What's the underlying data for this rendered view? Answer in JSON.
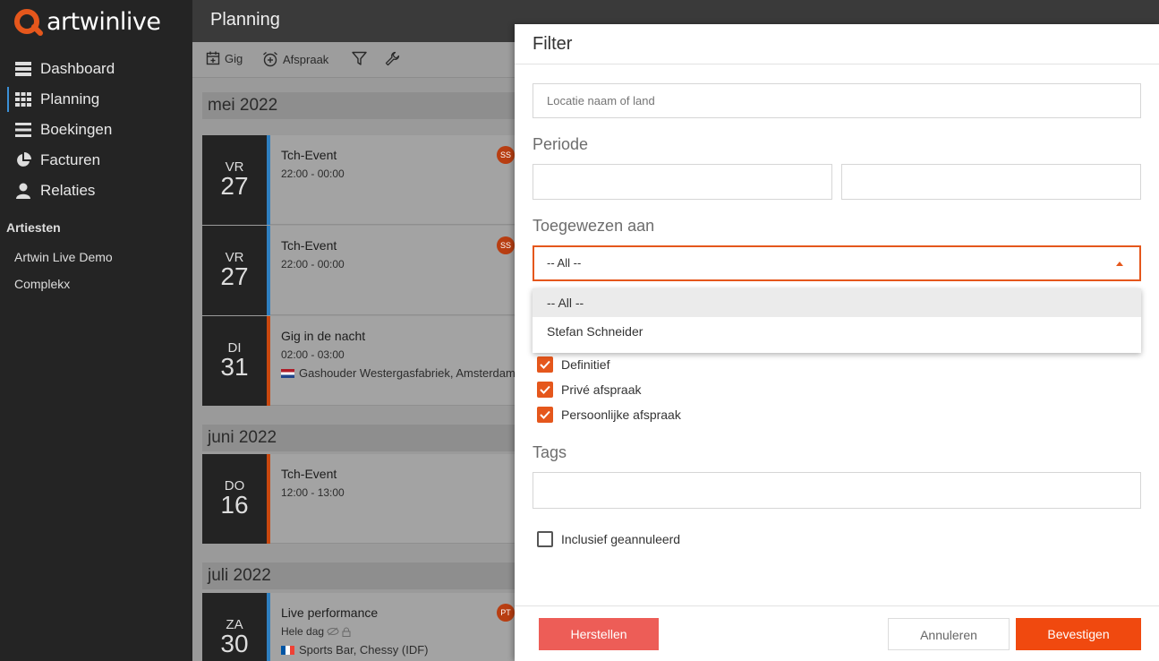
{
  "brand": {
    "logo_text": "artwinlive",
    "accent": "#e5571c"
  },
  "sidebar": {
    "items": [
      {
        "label": "Dashboard",
        "icon": "dashboard-icon"
      },
      {
        "label": "Planning",
        "icon": "grid-icon",
        "active": true
      },
      {
        "label": "Boekingen",
        "icon": "list-icon"
      },
      {
        "label": "Facturen",
        "icon": "pie-chart-icon"
      },
      {
        "label": "Relaties",
        "icon": "user-icon"
      }
    ],
    "section_title": "Artiesten",
    "artists": [
      "Artwin Live Demo",
      "Complekx"
    ]
  },
  "header": {
    "title": "Planning"
  },
  "toolbar": {
    "gig_label": "Gig",
    "afspraak_label": "Afspraak"
  },
  "months": [
    "mei 2022",
    "juni 2022",
    "juli 2022"
  ],
  "events": [
    {
      "dow": "VR",
      "day": "27",
      "title": "Tch-Event",
      "time": "22:00 - 00:00",
      "badge": "SS",
      "stripe": "#2f7fc0"
    },
    {
      "dow": "VR",
      "day": "27",
      "title": "Tch-Event",
      "time": "22:00 - 00:00",
      "badge": "SS",
      "stripe": "#2f7fc0"
    },
    {
      "dow": "DI",
      "day": "31",
      "title": "Gig in de nacht",
      "time": "02:00 - 03:00",
      "location": "Gashouder Westergasfabriek, Amsterdam",
      "stripe": "#c9480f"
    },
    {
      "dow": "DO",
      "day": "16",
      "title": "Tch-Event",
      "time": "12:00 - 13:00",
      "stripe": "#c9480f"
    },
    {
      "dow": "ZA",
      "day": "30",
      "title": "Live performance",
      "time": "Hele dag",
      "location": "Sports Bar, Chessy (IDF)",
      "badge": "PT",
      "stripe": "#2f7fc0"
    }
  ],
  "filter": {
    "title": "Filter",
    "location_placeholder": "Locatie naam of land",
    "periode_label": "Periode",
    "assigned_label": "Toegewezen aan",
    "assigned_value": "-- All --",
    "dropdown_options": [
      "-- All --",
      "Stefan Schneider"
    ],
    "checkboxes": [
      {
        "label": "Definitief",
        "checked": true
      },
      {
        "label": "Privé afspraak",
        "checked": true
      },
      {
        "label": "Persoonlijke afspraak",
        "checked": true
      }
    ],
    "tags_label": "Tags",
    "include_cancelled_label": "Inclusief geannuleerd",
    "include_cancelled_checked": false,
    "reset_label": "Herstellen",
    "cancel_label": "Annuleren",
    "confirm_label": "Bevestigen"
  }
}
